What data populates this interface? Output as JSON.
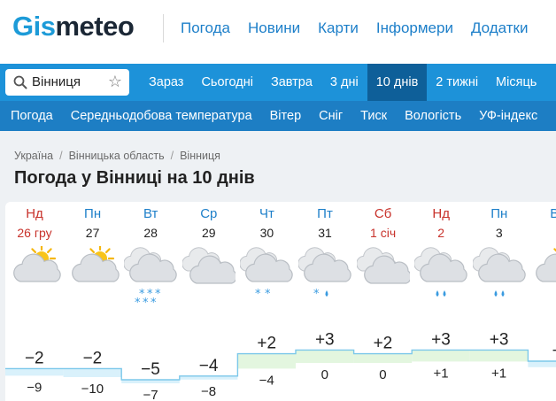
{
  "header": {
    "logo_part1": "Gis",
    "logo_part2": "meteo",
    "nav": [
      "Погода",
      "Новини",
      "Карти",
      "Інформери",
      "Додатки"
    ]
  },
  "search": {
    "value": "Вінниця"
  },
  "periods": [
    "Зараз",
    "Сьогодні",
    "Завтра",
    "3 дні",
    "10 днів",
    "2 тижні",
    "Місяць"
  ],
  "active_period": "10 днів",
  "subnav": [
    "Погода",
    "Середньодобова температура",
    "Вітер",
    "Сніг",
    "Тиск",
    "Вологість",
    "УФ-індекс"
  ],
  "breadcrumb": [
    "Україна",
    "Вінницька область",
    "Вінниця"
  ],
  "page_title": "Погода у Вінниці на 10 днів",
  "days": [
    {
      "name": "Нд",
      "date": "26 гру",
      "weekend": true,
      "icon": "sun-cloud-icon",
      "precip": "none",
      "max": "−2",
      "min": "−9"
    },
    {
      "name": "Пн",
      "date": "27",
      "weekend": false,
      "icon": "sun-cloud-icon",
      "precip": "none",
      "max": "−2",
      "min": "−10"
    },
    {
      "name": "Вт",
      "date": "28",
      "weekend": false,
      "icon": "cloudy-icon",
      "precip": "snow-heavy",
      "max": "−5",
      "min": "−7"
    },
    {
      "name": "Ср",
      "date": "29",
      "weekend": false,
      "icon": "overcast-icon",
      "precip": "none",
      "max": "−4",
      "min": "−8"
    },
    {
      "name": "Чт",
      "date": "30",
      "weekend": false,
      "icon": "cloudy-icon",
      "precip": "snow-light",
      "max": "+2",
      "min": "−4"
    },
    {
      "name": "Пт",
      "date": "31",
      "weekend": false,
      "icon": "cloudy-icon",
      "precip": "sleet",
      "max": "+3",
      "min": "0"
    },
    {
      "name": "Сб",
      "date": "1 січ",
      "weekend": true,
      "icon": "overcast-icon",
      "precip": "none",
      "max": "+2",
      "min": "0"
    },
    {
      "name": "Нд",
      "date": "2",
      "weekend": true,
      "icon": "cloudy-icon",
      "precip": "rain",
      "max": "+3",
      "min": "+1"
    },
    {
      "name": "Пн",
      "date": "3",
      "weekend": false,
      "icon": "cloudy-icon",
      "precip": "rain",
      "max": "+3",
      "min": "+1"
    },
    {
      "name": "Вт",
      "date": "",
      "weekend": false,
      "icon": "sun-cloud-icon",
      "precip": "none",
      "max": "+",
      "min": ""
    }
  ],
  "colors": {
    "brand_blue": "#1d92d9",
    "active_tab": "#0e5f99",
    "subnav": "#1d7ec4",
    "weekend_red": "#c8322b",
    "weekday_blue": "#1d7fc9"
  }
}
